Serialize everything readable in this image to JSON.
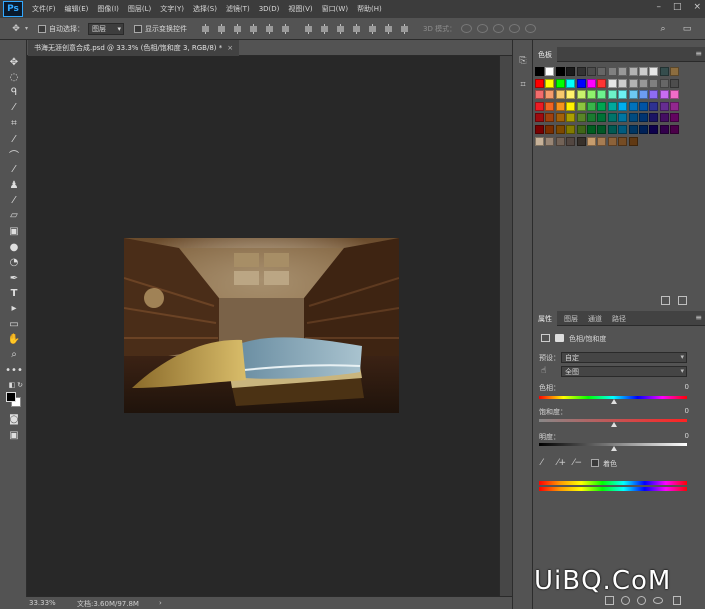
{
  "app": {
    "logo": "Ps"
  },
  "menu": [
    "文件(F)",
    "编辑(E)",
    "图像(I)",
    "图层(L)",
    "文字(Y)",
    "选择(S)",
    "滤镜(T)",
    "3D(D)",
    "视图(V)",
    "窗口(W)",
    "帮助(H)"
  ],
  "window_controls": [
    "–",
    "□",
    "×"
  ],
  "options_bar": {
    "auto_select_label": "自动选择：",
    "auto_select_value": "图层",
    "show_transform_label": "显示变换控件",
    "mode_3d_label": "3D 模式："
  },
  "document": {
    "tab_title": "书海无涯创意合成.psd @ 33.3% (色相/饱和度 3, RGB/8) *",
    "tab_close": "×"
  },
  "status_bar": {
    "zoom": "33.33%",
    "doc_info": "文档:3.60M/97.8M",
    "arrow": "›"
  },
  "swatches_panel": {
    "tab": "色板",
    "menu_icon": "≡"
  },
  "properties_panel": {
    "tabs": [
      "属性",
      "图层",
      "通道",
      "路径"
    ],
    "menu_icon": "≡",
    "adjustment_title": "色相/饱和度",
    "preset_label": "预设：",
    "preset_value": "自定",
    "channel_value": "全图",
    "hue_label": "色相：",
    "hue_value": "0",
    "saturation_label": "饱和度：",
    "saturation_value": "0",
    "lightness_label": "明度：",
    "lightness_value": "0",
    "colorize_label": "着色"
  },
  "icons": {
    "move": "move-icon",
    "marquee": "marquee-icon",
    "lasso": "lasso-icon",
    "magic_wand": "magic-wand-icon",
    "crop": "crop-icon",
    "eyedropper": "eyedropper-icon",
    "healing": "healing-brush-icon",
    "brush": "brush-icon",
    "stamp": "clone-stamp-icon",
    "history_brush": "history-brush-icon",
    "eraser": "eraser-icon",
    "gradient": "gradient-icon",
    "blur": "blur-icon",
    "dodge": "dodge-icon",
    "pen": "pen-icon",
    "type": "type-icon",
    "path_select": "path-selection-icon",
    "shape": "shape-icon",
    "hand": "hand-icon",
    "zoom": "zoom-icon",
    "more": "more-tools-icon"
  },
  "colors": {
    "app_bg": "#535353",
    "canvas_bg": "#282828",
    "menubar_bg": "#3c3c3c",
    "accent": "#31a8ff"
  },
  "watermark": "UiBQ.CoM"
}
